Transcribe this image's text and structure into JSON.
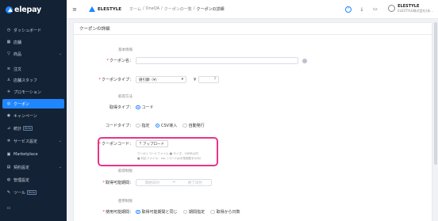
{
  "app": {
    "logo_text": "elepay"
  },
  "sidebar": {
    "items": [
      {
        "icon": "dashboard-icon",
        "glyph": "◷",
        "label": "ダッシュボード",
        "chevron": ""
      },
      {
        "icon": "store-icon",
        "glyph": "▦",
        "label": "店舗",
        "chevron": ""
      },
      {
        "icon": "product-icon",
        "glyph": "▽",
        "label": "商品",
        "chevron": "⌄"
      },
      {
        "icon": "order-icon",
        "glyph": "≡",
        "label": "注文",
        "chevron": ""
      },
      {
        "icon": "staff-icon",
        "glyph": "♙",
        "label": "店舗スタッフ",
        "chevron": ""
      },
      {
        "icon": "promotion-icon",
        "glyph": "✈",
        "label": "プロモーション",
        "chevron": ""
      },
      {
        "icon": "coupon-icon",
        "glyph": "◎",
        "label": "クーポン",
        "chevron": ""
      },
      {
        "icon": "campaign-icon",
        "glyph": "◉",
        "label": "キャンペーン",
        "chevron": ""
      },
      {
        "icon": "stats-icon",
        "glyph": "⊿",
        "label": "統計",
        "chevron": "",
        "badge": "Beta"
      },
      {
        "icon": "service-settings-icon",
        "glyph": "✲",
        "label": "サービス設定",
        "chevron": "⌄"
      },
      {
        "icon": "marketplace-icon",
        "glyph": "▣",
        "label": "Marketplace",
        "chevron": ""
      },
      {
        "icon": "contract-icon",
        "glyph": "▤",
        "label": "契約設定",
        "chevron": "⌄"
      },
      {
        "icon": "admin-icon",
        "glyph": "◍",
        "label": "管理設定",
        "chevron": ""
      },
      {
        "icon": "tools-icon",
        "glyph": "✎",
        "label": "ツール",
        "chevron": "",
        "badge": "Beta"
      },
      {
        "icon": "language-icon",
        "glyph": "▭",
        "label": "",
        "chevron": ""
      }
    ],
    "active_index": 6
  },
  "topbar": {
    "menu_icon": "≡",
    "brand": "ELESTYLE",
    "breadcrumb": [
      "ホーム",
      "/",
      "OneQA",
      "/",
      "クーポンの一覧",
      "/",
      "クーポンの詳細"
    ],
    "user_name": "ELESTYLE",
    "user_company": "ELESTYLE株式会社(未..."
  },
  "page": {
    "title": "クーポンの詳細",
    "section_basic": "基本情報",
    "coupon_name_label": "クーポン名：",
    "coupon_name_value": "",
    "coupon_type_label": "クーポンタイプ：",
    "coupon_type_value": "値引額（¥）",
    "coupon_type_caret": "▾",
    "currency_symbol": "¥",
    "amount_value": "",
    "amount_hint": "?",
    "section_acquire": "取得方法",
    "acquire_type_label": "取得タイプ：",
    "acquire_type_options": [
      "コード"
    ],
    "code_type_label": "コードタイプ：",
    "code_type_options": [
      "指定",
      "CSV導入",
      "自動発行"
    ],
    "coupon_code_label": "クーポンコード：",
    "upload_icon": "⤒",
    "upload_label": "アップロード",
    "upload_hint_1": "クーポンコードファイル ■ サイズ：20MB以内",
    "upload_hint_2": "■ 対応ファイル：csv（コードは半角英数字のみ）",
    "section_acquire_limit": "取得制限",
    "acquire_period_label": "取得可能期間：",
    "start_date_placeholder": "開始日付",
    "date_separator": "→",
    "end_date_placeholder": "終了日付",
    "section_use_limit": "使用制限",
    "use_period_label": "使用可能期間：",
    "use_period_options": [
      "取得可能期間と同じ",
      "期間指定",
      "取得から日数"
    ]
  }
}
